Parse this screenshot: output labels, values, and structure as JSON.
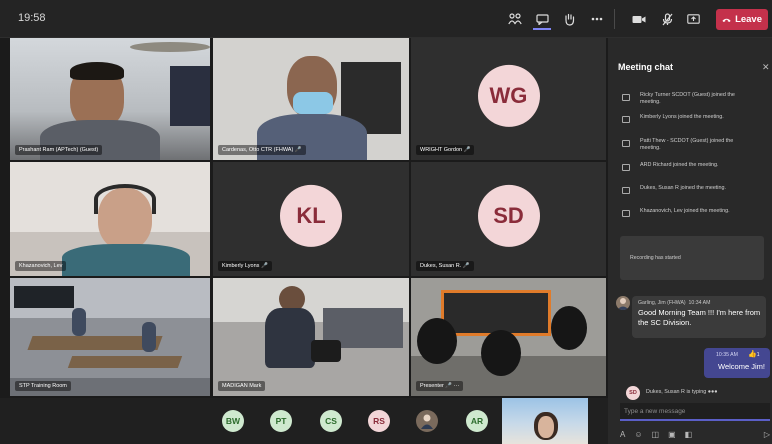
{
  "topbar": {
    "time": "19:58",
    "icons": [
      "people-icon",
      "chat-icon",
      "raise-hand-icon",
      "more-icon",
      "camera-icon",
      "mic-off-icon",
      "share-icon"
    ],
    "leave_label": "Leave",
    "leave_color": "#c4314b"
  },
  "tiles": [
    {
      "name": "Prashant Ram (APTech) (Guest)",
      "type": "video"
    },
    {
      "name": "Cardenas, Otto CTR (FHWA)",
      "type": "video"
    },
    {
      "name": "WRIGHT Gordon",
      "type": "avatar",
      "initials": "WG"
    },
    {
      "name": "Khazanovich, Lev",
      "type": "video"
    },
    {
      "name": "Kimberly Lyons",
      "type": "avatar",
      "initials": "KL"
    },
    {
      "name": "Dukes, Susan R.",
      "type": "avatar",
      "initials": "SD"
    },
    {
      "name": "STP Training Room",
      "type": "video"
    },
    {
      "name": "MADIGAN Mark",
      "type": "video"
    },
    {
      "name": "Presenter",
      "type": "video"
    }
  ],
  "bottom_participants": [
    "BW",
    "PT",
    "CS",
    "RS",
    "AR"
  ],
  "chat": {
    "title": "Meeting chat",
    "events": [
      "Ricky Turner SCDOT (Guest) joined the meeting.",
      "Kimberly Lyons joined the meeting.",
      "Patti Thew - SCDOT (Guest) joined the meeting.",
      "ARD Richard joined the meeting.",
      "Dukes, Susan R joined the meeting.",
      "Khazanovich, Lev joined the meeting."
    ],
    "recording": "Recording has started",
    "incoming": {
      "sender": "Garling, Jim (FHWA)",
      "time": "10:34 AM",
      "text": "Good Morning Team !!! I'm here from the SC Division."
    },
    "outgoing": {
      "time": "10:35 AM",
      "text": "Welcome Jim!",
      "reaction": "1"
    },
    "typing": "Dukes, Susan R is typing",
    "typing_initials": "SD",
    "compose_placeholder": "Type a new message"
  }
}
